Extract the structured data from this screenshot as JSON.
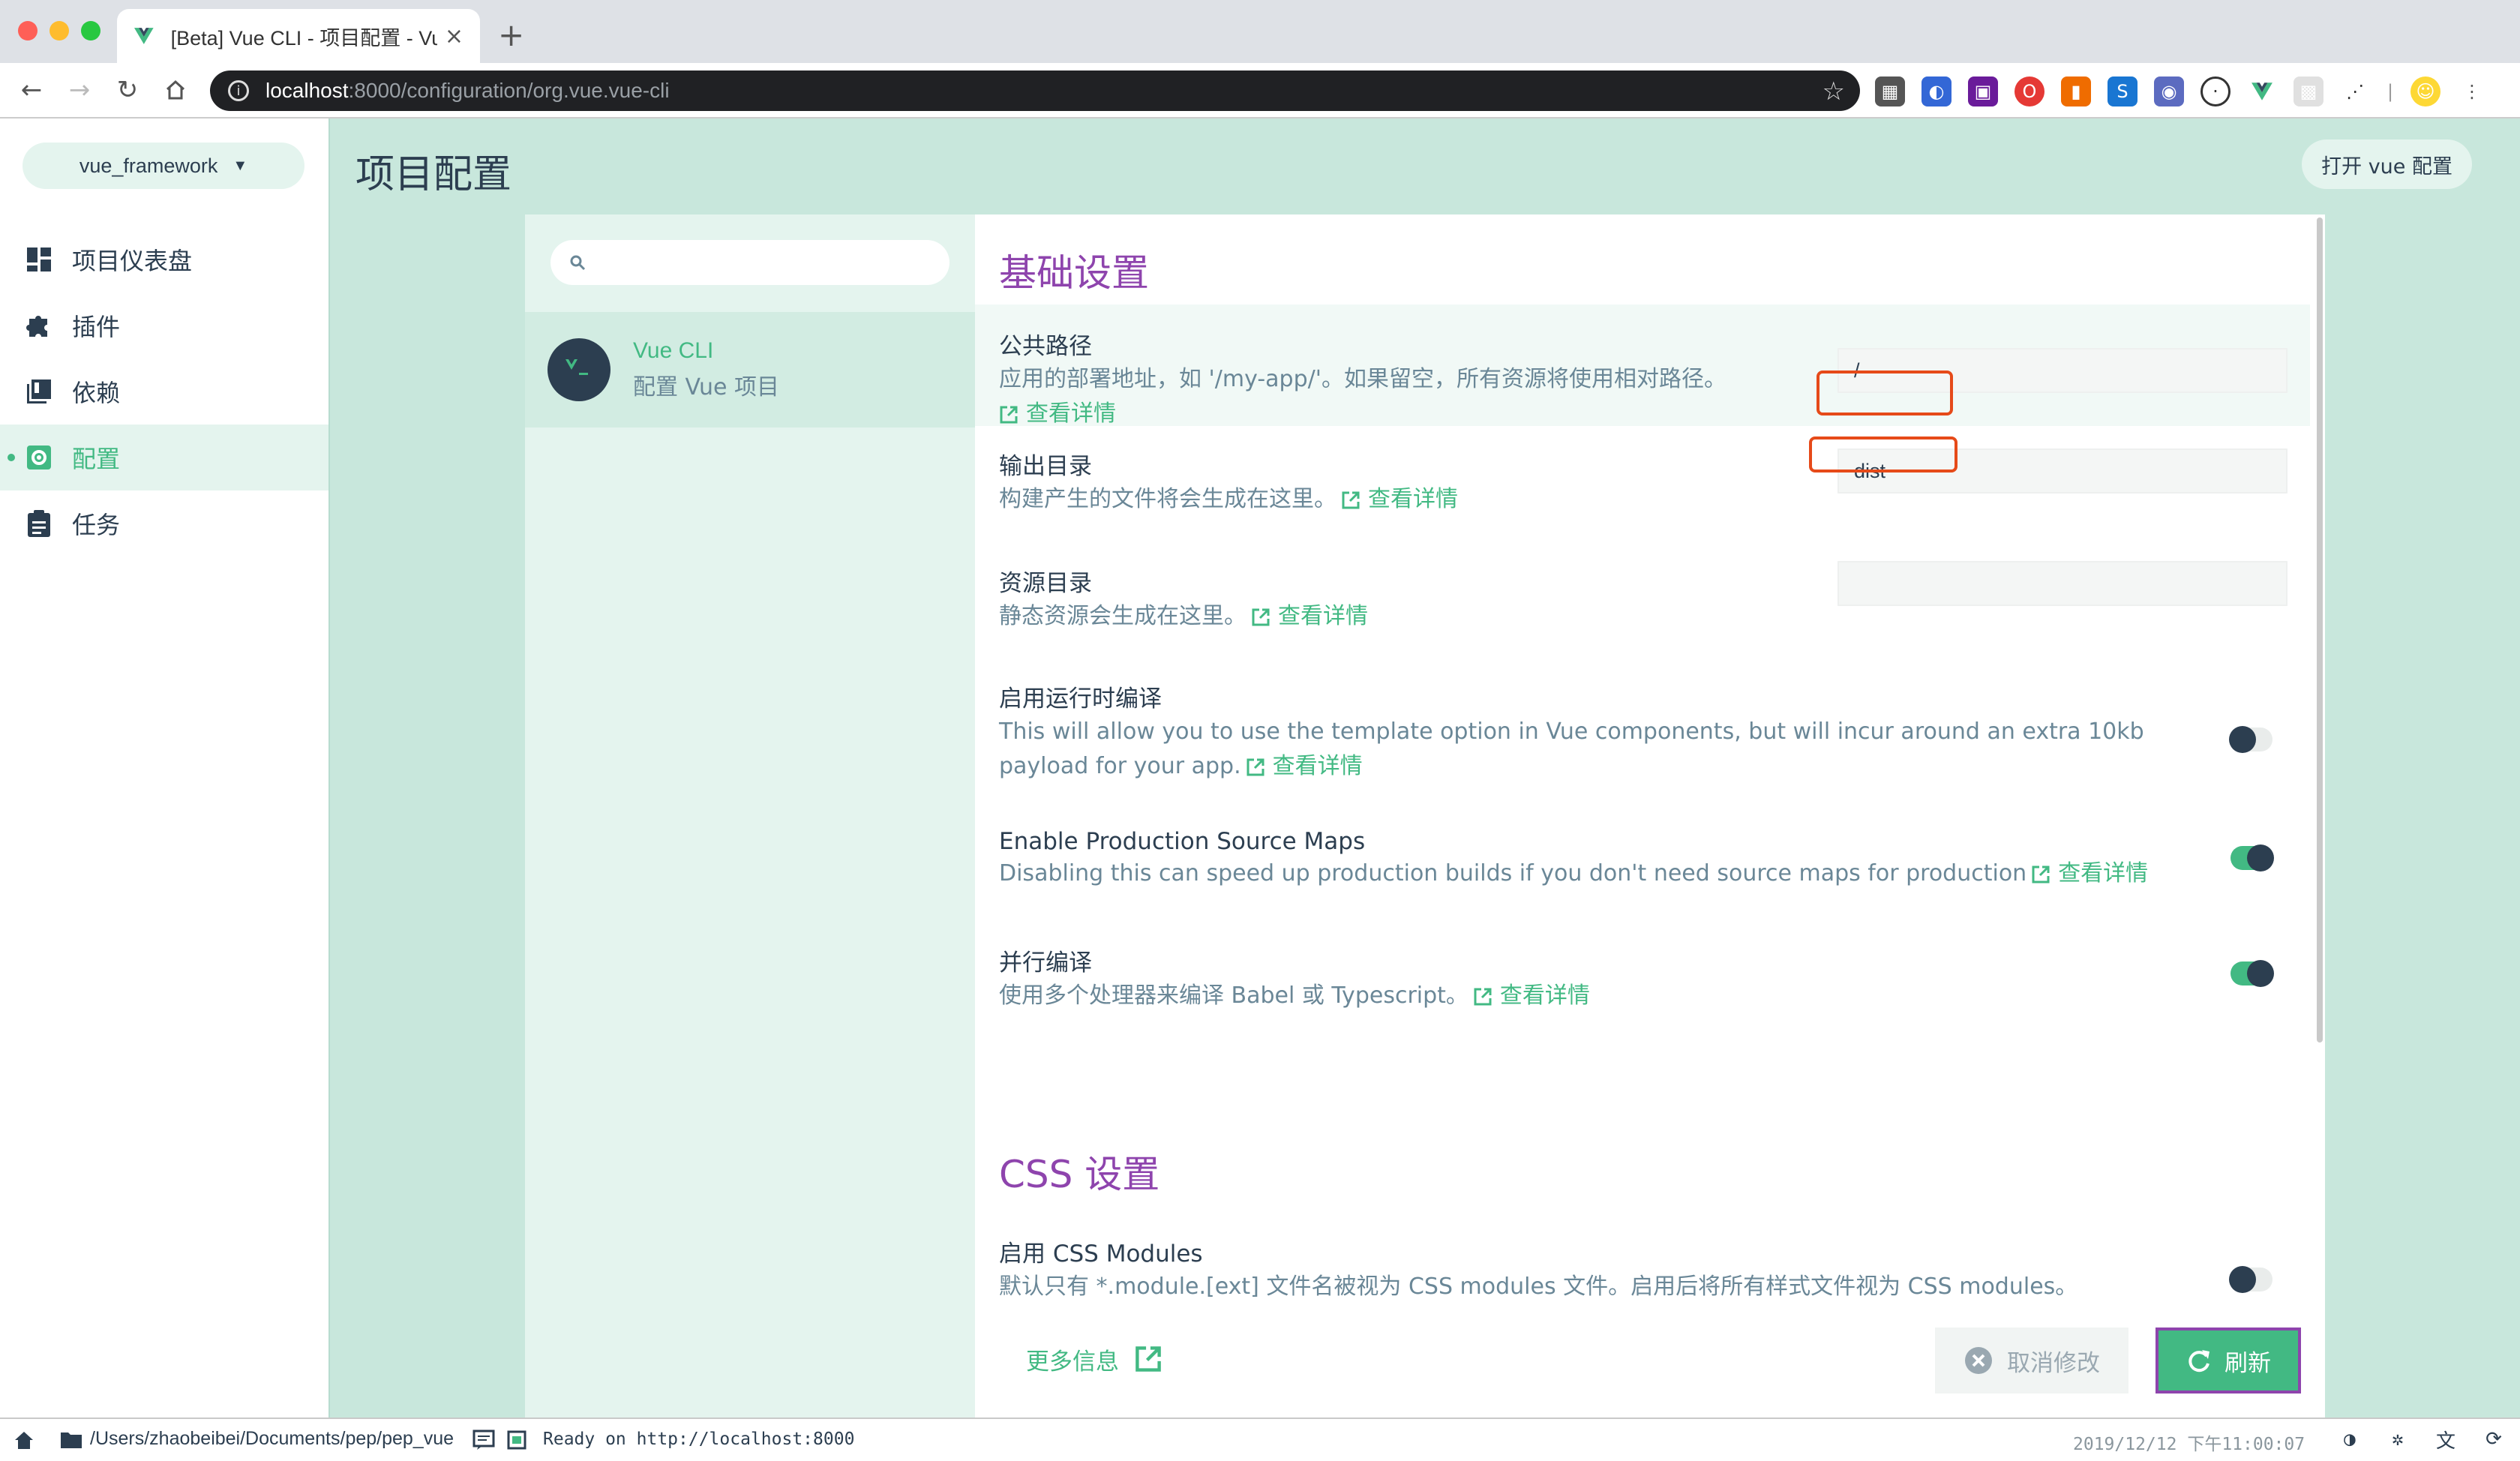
{
  "browser": {
    "tab_title": "[Beta] Vue CLI - 项目配置 - Vue",
    "url_host": "localhost",
    "url_path": ":8000/configuration/org.vue.vue-cli"
  },
  "sidebar": {
    "project": "vue_framework",
    "items": [
      {
        "label": "项目仪表盘"
      },
      {
        "label": "插件"
      },
      {
        "label": "依赖"
      },
      {
        "label": "配置"
      },
      {
        "label": "任务"
      }
    ]
  },
  "header": {
    "title": "项目配置",
    "open_config": "打开 vue 配置"
  },
  "plugin_list": {
    "search_placeholder": "",
    "items": [
      {
        "name": "Vue CLI",
        "desc": "配置 Vue 项目"
      }
    ]
  },
  "config": {
    "base_section": "基础设置",
    "css_section": "CSS 设置",
    "more_label": "查看详情",
    "settings": [
      {
        "label": "公共路径",
        "desc": "应用的部署地址，如 '/my-app/'。如果留空，所有资源将使用相对路径。",
        "value": "/"
      },
      {
        "label": "输出目录",
        "desc": "构建产生的文件将会生成在这里。",
        "value": "dist"
      },
      {
        "label": "资源目录",
        "desc": "静态资源会生成在这里。",
        "value": ""
      },
      {
        "label": "启用运行时编译",
        "desc": "This will allow you to use the template option in Vue components, but will incur around an extra 10kb payload for your app.",
        "enabled": false
      },
      {
        "label": "Enable Production Source Maps",
        "desc": "Disabling this can speed up production builds if you don't need source maps for production",
        "enabled": true
      },
      {
        "label": "并行编译",
        "desc": "使用多个处理器来编译 Babel 或 Typescript。",
        "enabled": true
      },
      {
        "label": "启用 CSS Modules",
        "desc": "默认只有 *.module.[ext] 文件名被视为 CSS modules 文件。启用后将所有样式文件视为 CSS modules。",
        "enabled": false
      }
    ]
  },
  "footer": {
    "more_info": "更多信息",
    "cancel": "取消修改",
    "refresh": "刷新"
  },
  "statusbar": {
    "path": "/Users/zhaobeibei/Documents/pep/pep_vue",
    "ready": "Ready on http://localhost:8000",
    "time": "2019/12/12  下午11:00:07"
  },
  "colors": {
    "accent": "#42b983",
    "dark": "#2c3e50",
    "section": "#8e44ad",
    "annotation": "#e64a19"
  }
}
